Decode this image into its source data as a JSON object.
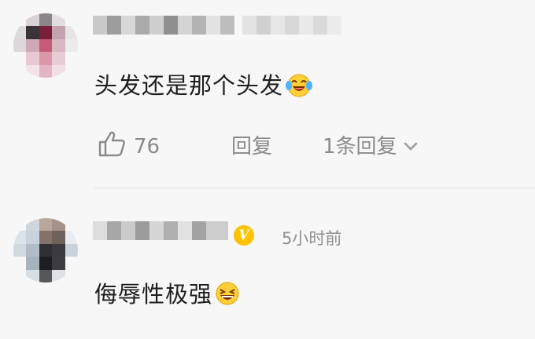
{
  "comments": [
    {
      "text": "头发还是那个头发",
      "emoji": "laughing-crying-emoji",
      "likes": "76",
      "reply_label": "回复",
      "replies_label": "1条回复"
    },
    {
      "text": "侮辱性极强",
      "emoji": "laughing-emoji",
      "time": "5小时前",
      "verified_badge": "V"
    }
  ],
  "colors": {
    "background": "#f7f7f7",
    "muted_text": "#8a8a8a",
    "verified": "#ffc200"
  }
}
